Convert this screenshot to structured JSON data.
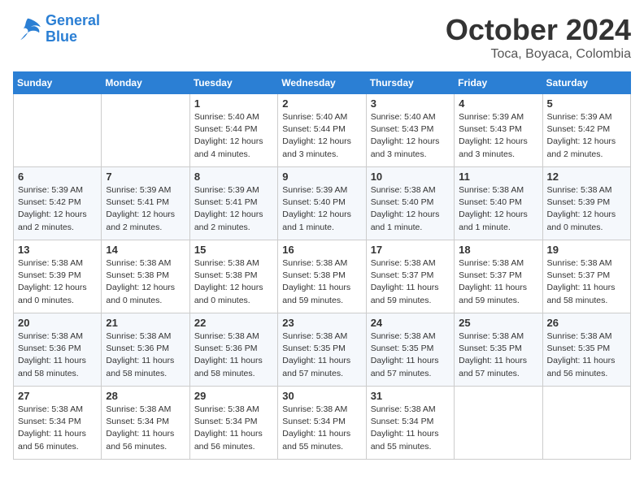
{
  "logo": {
    "line1": "General",
    "line2": "Blue"
  },
  "title": "October 2024",
  "location": "Toca, Boyaca, Colombia",
  "weekdays": [
    "Sunday",
    "Monday",
    "Tuesday",
    "Wednesday",
    "Thursday",
    "Friday",
    "Saturday"
  ],
  "weeks": [
    [
      {
        "day": "",
        "info": ""
      },
      {
        "day": "",
        "info": ""
      },
      {
        "day": "1",
        "info": "Sunrise: 5:40 AM\nSunset: 5:44 PM\nDaylight: 12 hours\nand 4 minutes."
      },
      {
        "day": "2",
        "info": "Sunrise: 5:40 AM\nSunset: 5:44 PM\nDaylight: 12 hours\nand 3 minutes."
      },
      {
        "day": "3",
        "info": "Sunrise: 5:40 AM\nSunset: 5:43 PM\nDaylight: 12 hours\nand 3 minutes."
      },
      {
        "day": "4",
        "info": "Sunrise: 5:39 AM\nSunset: 5:43 PM\nDaylight: 12 hours\nand 3 minutes."
      },
      {
        "day": "5",
        "info": "Sunrise: 5:39 AM\nSunset: 5:42 PM\nDaylight: 12 hours\nand 2 minutes."
      }
    ],
    [
      {
        "day": "6",
        "info": "Sunrise: 5:39 AM\nSunset: 5:42 PM\nDaylight: 12 hours\nand 2 minutes."
      },
      {
        "day": "7",
        "info": "Sunrise: 5:39 AM\nSunset: 5:41 PM\nDaylight: 12 hours\nand 2 minutes."
      },
      {
        "day": "8",
        "info": "Sunrise: 5:39 AM\nSunset: 5:41 PM\nDaylight: 12 hours\nand 2 minutes."
      },
      {
        "day": "9",
        "info": "Sunrise: 5:39 AM\nSunset: 5:40 PM\nDaylight: 12 hours\nand 1 minute."
      },
      {
        "day": "10",
        "info": "Sunrise: 5:38 AM\nSunset: 5:40 PM\nDaylight: 12 hours\nand 1 minute."
      },
      {
        "day": "11",
        "info": "Sunrise: 5:38 AM\nSunset: 5:40 PM\nDaylight: 12 hours\nand 1 minute."
      },
      {
        "day": "12",
        "info": "Sunrise: 5:38 AM\nSunset: 5:39 PM\nDaylight: 12 hours\nand 0 minutes."
      }
    ],
    [
      {
        "day": "13",
        "info": "Sunrise: 5:38 AM\nSunset: 5:39 PM\nDaylight: 12 hours\nand 0 minutes."
      },
      {
        "day": "14",
        "info": "Sunrise: 5:38 AM\nSunset: 5:38 PM\nDaylight: 12 hours\nand 0 minutes."
      },
      {
        "day": "15",
        "info": "Sunrise: 5:38 AM\nSunset: 5:38 PM\nDaylight: 12 hours\nand 0 minutes."
      },
      {
        "day": "16",
        "info": "Sunrise: 5:38 AM\nSunset: 5:38 PM\nDaylight: 11 hours\nand 59 minutes."
      },
      {
        "day": "17",
        "info": "Sunrise: 5:38 AM\nSunset: 5:37 PM\nDaylight: 11 hours\nand 59 minutes."
      },
      {
        "day": "18",
        "info": "Sunrise: 5:38 AM\nSunset: 5:37 PM\nDaylight: 11 hours\nand 59 minutes."
      },
      {
        "day": "19",
        "info": "Sunrise: 5:38 AM\nSunset: 5:37 PM\nDaylight: 11 hours\nand 58 minutes."
      }
    ],
    [
      {
        "day": "20",
        "info": "Sunrise: 5:38 AM\nSunset: 5:36 PM\nDaylight: 11 hours\nand 58 minutes."
      },
      {
        "day": "21",
        "info": "Sunrise: 5:38 AM\nSunset: 5:36 PM\nDaylight: 11 hours\nand 58 minutes."
      },
      {
        "day": "22",
        "info": "Sunrise: 5:38 AM\nSunset: 5:36 PM\nDaylight: 11 hours\nand 58 minutes."
      },
      {
        "day": "23",
        "info": "Sunrise: 5:38 AM\nSunset: 5:35 PM\nDaylight: 11 hours\nand 57 minutes."
      },
      {
        "day": "24",
        "info": "Sunrise: 5:38 AM\nSunset: 5:35 PM\nDaylight: 11 hours\nand 57 minutes."
      },
      {
        "day": "25",
        "info": "Sunrise: 5:38 AM\nSunset: 5:35 PM\nDaylight: 11 hours\nand 57 minutes."
      },
      {
        "day": "26",
        "info": "Sunrise: 5:38 AM\nSunset: 5:35 PM\nDaylight: 11 hours\nand 56 minutes."
      }
    ],
    [
      {
        "day": "27",
        "info": "Sunrise: 5:38 AM\nSunset: 5:34 PM\nDaylight: 11 hours\nand 56 minutes."
      },
      {
        "day": "28",
        "info": "Sunrise: 5:38 AM\nSunset: 5:34 PM\nDaylight: 11 hours\nand 56 minutes."
      },
      {
        "day": "29",
        "info": "Sunrise: 5:38 AM\nSunset: 5:34 PM\nDaylight: 11 hours\nand 56 minutes."
      },
      {
        "day": "30",
        "info": "Sunrise: 5:38 AM\nSunset: 5:34 PM\nDaylight: 11 hours\nand 55 minutes."
      },
      {
        "day": "31",
        "info": "Sunrise: 5:38 AM\nSunset: 5:34 PM\nDaylight: 11 hours\nand 55 minutes."
      },
      {
        "day": "",
        "info": ""
      },
      {
        "day": "",
        "info": ""
      }
    ]
  ]
}
